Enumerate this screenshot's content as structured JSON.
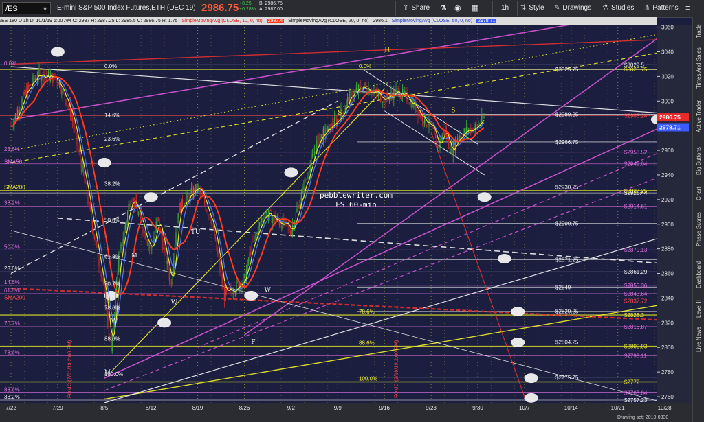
{
  "toolbar": {
    "symbol": "/ES",
    "instrument_title": "E-mini S&P 500 Index Futures,ETH (DEC 19)",
    "last_price": "2986.75",
    "change": "+8.25",
    "change_pct": "+0.28%",
    "bid": "B: 2986.75",
    "ask": "A: 2987.00",
    "share_label": "Share",
    "interval_label": "1h",
    "style_label": "Style",
    "drawings_label": "Drawings",
    "studies_label": "Studies",
    "patterns_label": "Patterns"
  },
  "legend": {
    "ohlc": "/ES 180 D 1h   D: 10/1/19 6:00 AM   O: 2987   H: 2987.25   L: 2985.5   C: 2986.75   R: 1.75",
    "sma10": "SimpleMovingAvg (CLOSE, 10, 0, no)",
    "sma10_value": "2987.4",
    "sma20": "SimpleMovingAvg (CLOSE, 20, 0, no)",
    "sma20_value": "2986.1",
    "sma50": "SimpleMovingAvg (CLOSE, 50, 0, no)",
    "sma50_value": "2978.71"
  },
  "side_tabs": [
    "Trade",
    "Times And Sales",
    "Active Trader",
    "Big Buttons",
    "Chart",
    "Phase Scores",
    "Dashboard",
    "Level II",
    "Live News"
  ],
  "footer": {
    "drawing_set": "Drawing set: 2019-0930"
  },
  "colors": {
    "background": "#1b1e3f",
    "grid_vertical": "#d6d62a",
    "candle_up": "#3fb03f",
    "candle_down": "#d02a2a",
    "sma10": "#ff3a1f",
    "sma20": "#4f7bff",
    "sma50": "#eaea2a",
    "fib": "#e8e8e8",
    "channel": "#d856d8",
    "last_price_tag": "#e82a2a",
    "sma50_tag": "#3b5bff"
  },
  "chart_data": {
    "type": "candlestick",
    "title": "",
    "watermark": [
      "pebblewriter.com",
      "ES 60-min"
    ],
    "xlabel": "",
    "ylabel": "",
    "ylim": [
      2755,
      3062
    ],
    "y_ticks": [
      2760,
      2780,
      2800,
      2820,
      2840,
      2860,
      2880,
      2900,
      2920,
      2940,
      2960,
      2980,
      3000,
      3020,
      3040,
      3060
    ],
    "x_ticks": [
      "7/22",
      "7/29",
      "8/5",
      "8/12",
      "8/19",
      "8/26",
      "9/2",
      "9/9",
      "9/16",
      "9/23",
      "9/30",
      "10/7",
      "10/14",
      "10/21",
      "10/28"
    ],
    "grid": "vertical dotted",
    "price_path": {
      "x": [
        "7/22",
        "7/24",
        "7/26",
        "7/29",
        "7/31",
        "8/2",
        "8/5",
        "8/6",
        "8/7",
        "8/9",
        "8/12",
        "8/13",
        "8/15",
        "8/16",
        "8/19",
        "8/21",
        "8/23",
        "8/26",
        "8/27",
        "8/29",
        "9/2",
        "9/4",
        "9/6",
        "9/9",
        "9/11",
        "9/13",
        "9/16",
        "9/18",
        "9/20",
        "9/23",
        "9/24",
        "9/25",
        "9/26",
        "9/27",
        "9/30",
        "10/1"
      ],
      "y": [
        2980,
        3005,
        3022,
        3018,
        2990,
        2935,
        2845,
        2795,
        2865,
        2925,
        2878,
        2905,
        2850,
        2912,
        2930,
        2905,
        2842,
        2855,
        2880,
        2910,
        2895,
        2932,
        2968,
        2985,
        3005,
        3012,
        3002,
        3008,
        3000,
        2978,
        2962,
        2978,
        2958,
        2972,
        2980,
        2987
      ]
    },
    "right_axis_tags": [
      {
        "label": "2986.75",
        "y": 2986.75,
        "color": "#e82a2a"
      },
      {
        "label": "2978.71",
        "y": 2978.71,
        "color": "#3b5bff"
      }
    ],
    "price_labels": [
      {
        "label": "$3029.5",
        "y": 3029.5,
        "color": "white"
      },
      {
        "label": "$3025.75",
        "y": 3025.75,
        "color": "yellow"
      },
      {
        "label": "$3025.75",
        "y": 3025.75,
        "color": "white",
        "col": "mid"
      },
      {
        "label": "$2989.25",
        "y": 2989.25,
        "color": "white",
        "col": "mid"
      },
      {
        "label": "$2988.24",
        "y": 2988.24,
        "color": "red"
      },
      {
        "label": "$2966.75",
        "y": 2966.75,
        "color": "white",
        "col": "mid"
      },
      {
        "label": "$2958.52",
        "y": 2958.52,
        "color": "violet"
      },
      {
        "label": "$2949.04",
        "y": 2949.04,
        "color": "violet"
      },
      {
        "label": "$2930.25",
        "y": 2930.25,
        "color": "white",
        "col": "mid"
      },
      {
        "label": "$2927.25",
        "y": 2927.25,
        "color": "yellow"
      },
      {
        "label": "$2925.44",
        "y": 2925.44,
        "color": "white"
      },
      {
        "label": "$2914.61",
        "y": 2914.61,
        "color": "violet"
      },
      {
        "label": "$2900.75",
        "y": 2900.75,
        "color": "white",
        "col": "mid"
      },
      {
        "label": "$2879.13",
        "y": 2879.13,
        "color": "violet"
      },
      {
        "label": "$2871.25",
        "y": 2871.25,
        "color": "white",
        "col": "mid"
      },
      {
        "label": "$2861.29",
        "y": 2861.29,
        "color": "white"
      },
      {
        "label": "$2850.36",
        "y": 2850.36,
        "color": "violet"
      },
      {
        "label": "$2849",
        "y": 2849,
        "color": "white",
        "col": "mid"
      },
      {
        "label": "$2843.64",
        "y": 2843.64,
        "color": "violet"
      },
      {
        "label": "$2837.72",
        "y": 2837.72,
        "color": "red"
      },
      {
        "label": "$2829.25",
        "y": 2829.25,
        "color": "white",
        "col": "mid"
      },
      {
        "label": "$2826.3",
        "y": 2826.3,
        "color": "yellow"
      },
      {
        "label": "$2816.87",
        "y": 2816.87,
        "color": "violet"
      },
      {
        "label": "$2804.25",
        "y": 2804.25,
        "color": "white",
        "col": "mid"
      },
      {
        "label": "$2800.93",
        "y": 2800.93,
        "color": "yellow"
      },
      {
        "label": "$2793.11",
        "y": 2793.11,
        "color": "violet"
      },
      {
        "label": "$2775.75",
        "y": 2775.75,
        "color": "white",
        "col": "mid"
      },
      {
        "label": "$2772",
        "y": 2772,
        "color": "yellow"
      },
      {
        "label": "$2763.04",
        "y": 2763.04,
        "color": "violet"
      },
      {
        "label": "$2757.23",
        "y": 2757.23,
        "color": "white"
      }
    ],
    "left_labels": [
      {
        "label": "0.0%",
        "y": 3028,
        "color": "violet"
      },
      {
        "label": "0.0%",
        "y": 3025.75,
        "color": "white",
        "col": "b"
      },
      {
        "label": "14.6%",
        "y": 2986,
        "color": "white",
        "col": "c"
      },
      {
        "label": "23.6%",
        "y": 2966.75,
        "color": "white",
        "col": "c"
      },
      {
        "label": "23.6%",
        "y": 2958.5,
        "color": "violet"
      },
      {
        "label": "SMA50",
        "y": 2948,
        "color": "violet"
      },
      {
        "label": "38.2%",
        "y": 2930.25,
        "color": "white",
        "col": "c"
      },
      {
        "label": "SMA200",
        "y": 2927.5,
        "color": "yellow"
      },
      {
        "label": "38.2%",
        "y": 2914.6,
        "color": "violet"
      },
      {
        "label": "50.0%",
        "y": 2900.75,
        "color": "white",
        "col": "c"
      },
      {
        "label": "50.0%",
        "y": 2879,
        "color": "violet"
      },
      {
        "label": "61.8%",
        "y": 2871.25,
        "color": "white",
        "col": "c"
      },
      {
        "label": "23.6%",
        "y": 2861.3,
        "color": "white"
      },
      {
        "label": "14.6%",
        "y": 2850.4,
        "color": "violet"
      },
      {
        "label": "70.7%",
        "y": 2849,
        "color": "white",
        "col": "c"
      },
      {
        "label": "61.8%",
        "y": 2843.6,
        "color": "violet"
      },
      {
        "label": "SMA200",
        "y": 2837.7,
        "color": "red"
      },
      {
        "label": "78.6%",
        "y": 2829.25,
        "color": "white",
        "col": "c"
      },
      {
        "label": "70.7%",
        "y": 2816.9,
        "color": "violet"
      },
      {
        "label": "88.6%",
        "y": 2804.25,
        "color": "white",
        "col": "c"
      },
      {
        "label": "78.6%",
        "y": 2793.1,
        "color": "violet"
      },
      {
        "label": "100.0%",
        "y": 2775.75,
        "color": "white",
        "col": "c"
      },
      {
        "label": "88.6%",
        "y": 2763,
        "color": "violet"
      },
      {
        "label": "38.2%",
        "y": 2757.2,
        "color": "white"
      },
      {
        "label": "78.6%",
        "y": 2826.3,
        "color": "yellow",
        "col": "d"
      },
      {
        "label": "88.6%",
        "y": 2800.9,
        "color": "yellow",
        "col": "d"
      },
      {
        "label": "100.0%",
        "y": 2772,
        "color": "yellow",
        "col": "d"
      },
      {
        "label": "0.0%",
        "y": 3025.75,
        "color": "yellow",
        "col": "e"
      }
    ],
    "pattern_labels": [
      {
        "label": "M",
        "x": "8/9",
        "y": 2873,
        "color": "white"
      },
      {
        "label": "M",
        "x": "8/5",
        "y": 2778,
        "color": "white"
      },
      {
        "label": "W",
        "x": "8/6",
        "y": 2820,
        "color": "white"
      },
      {
        "label": "W",
        "x": "8/15",
        "y": 2835,
        "color": "white"
      },
      {
        "label": "TU",
        "x": "8/18",
        "y": 2892,
        "color": "white"
      },
      {
        "label": "W",
        "x": "8/29",
        "y": 2845,
        "color": "white"
      },
      {
        "label": "F",
        "x": "8/27",
        "y": 2803,
        "color": "white"
      },
      {
        "label": "S",
        "x": "9/9",
        "y": 2989,
        "color": "yellow"
      },
      {
        "label": "H",
        "x": "9/16",
        "y": 3040,
        "color": "yellow"
      },
      {
        "label": "S",
        "x": "9/26",
        "y": 2991,
        "color": "yellow"
      }
    ],
    "vertical_notes": [
      {
        "label": "FOMC (7/31/19 2:00 PM)",
        "x": "7/31",
        "color": "red"
      },
      {
        "label": "FOMC (9/18/19 2:00 PM)",
        "x": "9/18",
        "color": "red"
      }
    ]
  }
}
